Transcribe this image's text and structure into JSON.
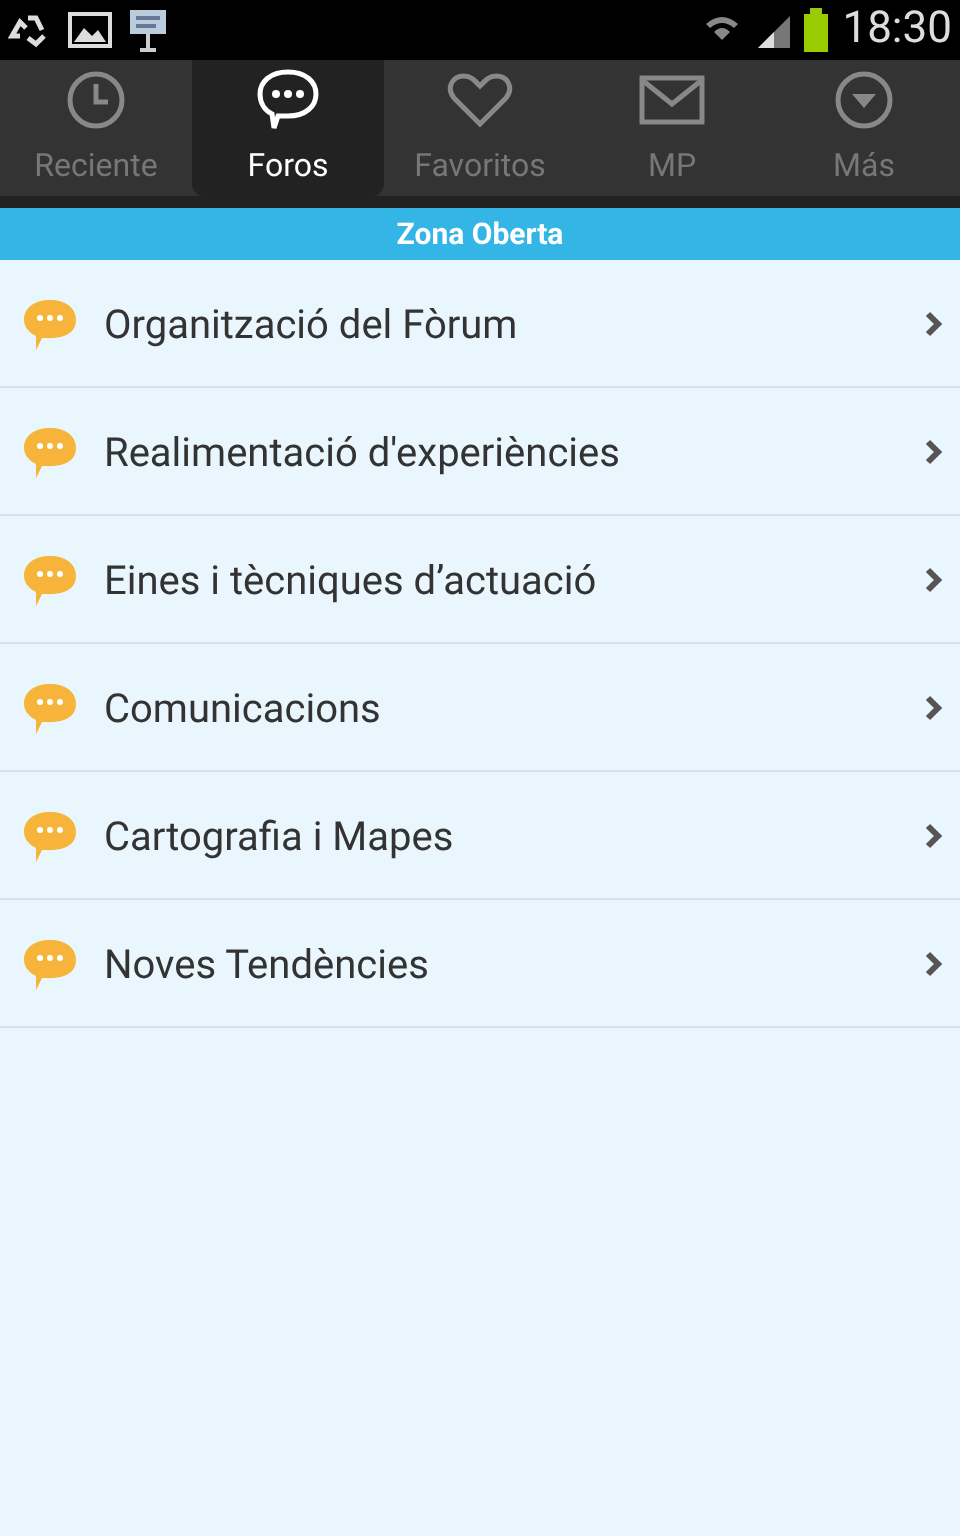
{
  "status_bar": {
    "time": "18:30"
  },
  "tabs": [
    {
      "label": "Reciente",
      "kind": "clock",
      "selected": false
    },
    {
      "label": "Foros",
      "kind": "chat",
      "selected": true
    },
    {
      "label": "Favoritos",
      "kind": "heart",
      "selected": false
    },
    {
      "label": "MP",
      "kind": "mail",
      "selected": false
    },
    {
      "label": "Más",
      "kind": "more",
      "selected": false
    }
  ],
  "section": {
    "title": "Zona Oberta"
  },
  "forums": [
    {
      "title": "Organització del Fòrum"
    },
    {
      "title": "Realimentació d'experiències"
    },
    {
      "title": "Eines i tècniques d’actuació"
    },
    {
      "title": "Comunicacions"
    },
    {
      "title": "Cartografia i Mapes"
    },
    {
      "title": "Noves Tendències"
    }
  ]
}
